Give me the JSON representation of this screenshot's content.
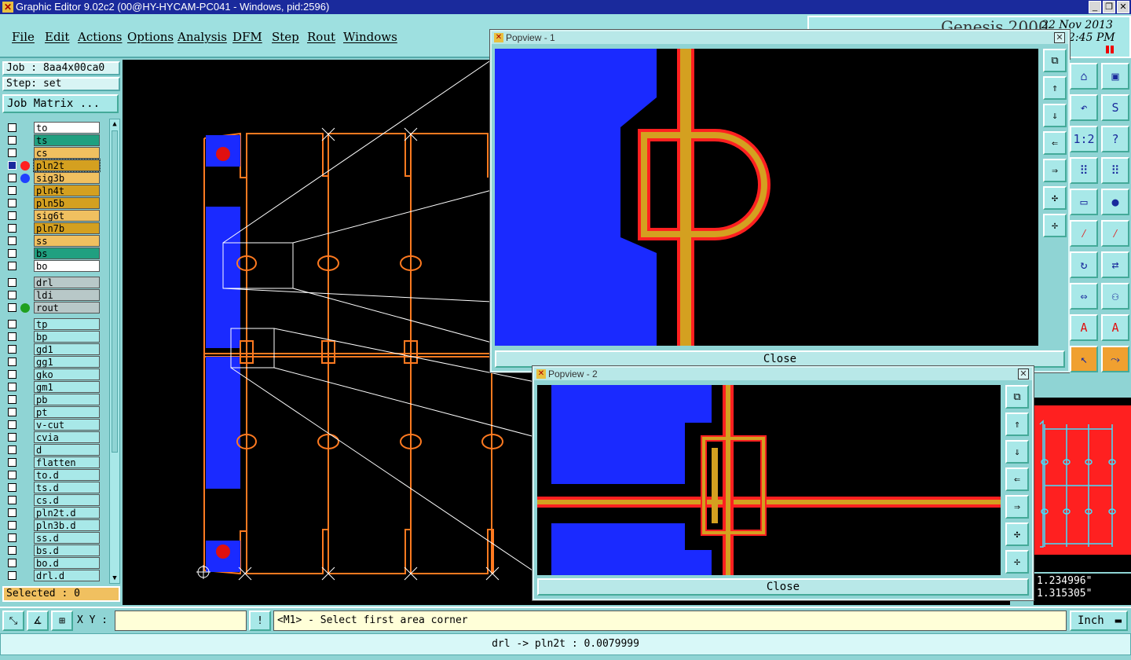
{
  "window": {
    "title": "Graphic Editor 9.02c2 (00@HY-HYCAM-PC041 - Windows, pid:2596)"
  },
  "menu": [
    "File",
    "Edit",
    "Actions",
    "Options",
    "Analysis",
    "DFM",
    "Step",
    "Rout",
    "Windows"
  ],
  "genesis": {
    "brand": "Genesis 2000",
    "date": "22 Nov 2013",
    "time": "2:45 PM"
  },
  "job": {
    "job_label": "Job : 8aa4x00ca0",
    "step_label": "Step: set",
    "matrix_button": "Job Matrix ..."
  },
  "layers": {
    "board": [
      {
        "name": "to",
        "color": "#ffffff"
      },
      {
        "name": "ts",
        "color": "#20a080"
      },
      {
        "name": "cs",
        "color": "#f0c060"
      },
      {
        "name": "pln2t",
        "color": "#d4a020",
        "selected": true,
        "dot": "#ff2020"
      },
      {
        "name": "sig3b",
        "color": "#f0c060",
        "dot": "#2040ff"
      },
      {
        "name": "pln4t",
        "color": "#d4a020"
      },
      {
        "name": "pln5b",
        "color": "#d4a020"
      },
      {
        "name": "sig6t",
        "color": "#f0c060"
      },
      {
        "name": "pln7b",
        "color": "#d4a020"
      },
      {
        "name": "ss",
        "color": "#f0c060"
      },
      {
        "name": "bs",
        "color": "#20a080"
      },
      {
        "name": "bo",
        "color": "#ffffff"
      }
    ],
    "drill": [
      {
        "name": "drl",
        "color": "#b8c8c8"
      },
      {
        "name": "ldi",
        "color": "#b8c8c8"
      },
      {
        "name": "rout",
        "color": "#b8c8c8",
        "dot": "#20a020"
      }
    ],
    "misc": [
      "tp",
      "bp",
      "gd1",
      "gg1",
      "gko",
      "gm1",
      "pb",
      "pt",
      "v-cut",
      "cvia",
      "d",
      "flatten",
      "to.d",
      "ts.d",
      "cs.d",
      "pln2t.d",
      "pln3b.d",
      "ss.d",
      "bs.d",
      "bo.d",
      "drl.d"
    ]
  },
  "selected_label": "Selected : 0",
  "popview1": {
    "title": "Popview - 1",
    "close": "Close"
  },
  "popview2": {
    "title": "Popview - 2",
    "close": "Close"
  },
  "coords": {
    "x": "1.234996\"",
    "y": "1.315305\""
  },
  "cmd": {
    "xy_label": "X Y :",
    "xy_value": "",
    "prompt": "<M1> - Select first area corner",
    "units": "Inch"
  },
  "status": "drl -> pln2t : 0.0079999",
  "colors": {
    "copper": "#d4a020",
    "outline": "#ff2020",
    "fill": "#1a2aff",
    "rout": "#ff7a20"
  },
  "right_tools": [
    "home-icon",
    "window-icon",
    "undo-icon",
    "redo-icon",
    "ratio-1-2-icon",
    "help-icon",
    "layer-compare-icon",
    "layer-compare-alt-icon",
    "ruler-icon",
    "pad-icon",
    "snap-icon",
    "snap-alt-icon",
    "rotate-icon",
    "mirror-icon",
    "measure-icon",
    "features-icon",
    "arc-icon",
    "arc-alt-icon",
    "pointer-icon",
    "route-icon"
  ],
  "right_tool_glyphs": [
    "⌂",
    "▣",
    "↶",
    "S",
    "1:2",
    "?",
    "⠿",
    "⠿",
    "▭",
    "●",
    "⁄",
    "⁄",
    "↻",
    "⇄",
    "⇔",
    "⚇",
    "A",
    "A",
    "↖",
    "⤳"
  ]
}
